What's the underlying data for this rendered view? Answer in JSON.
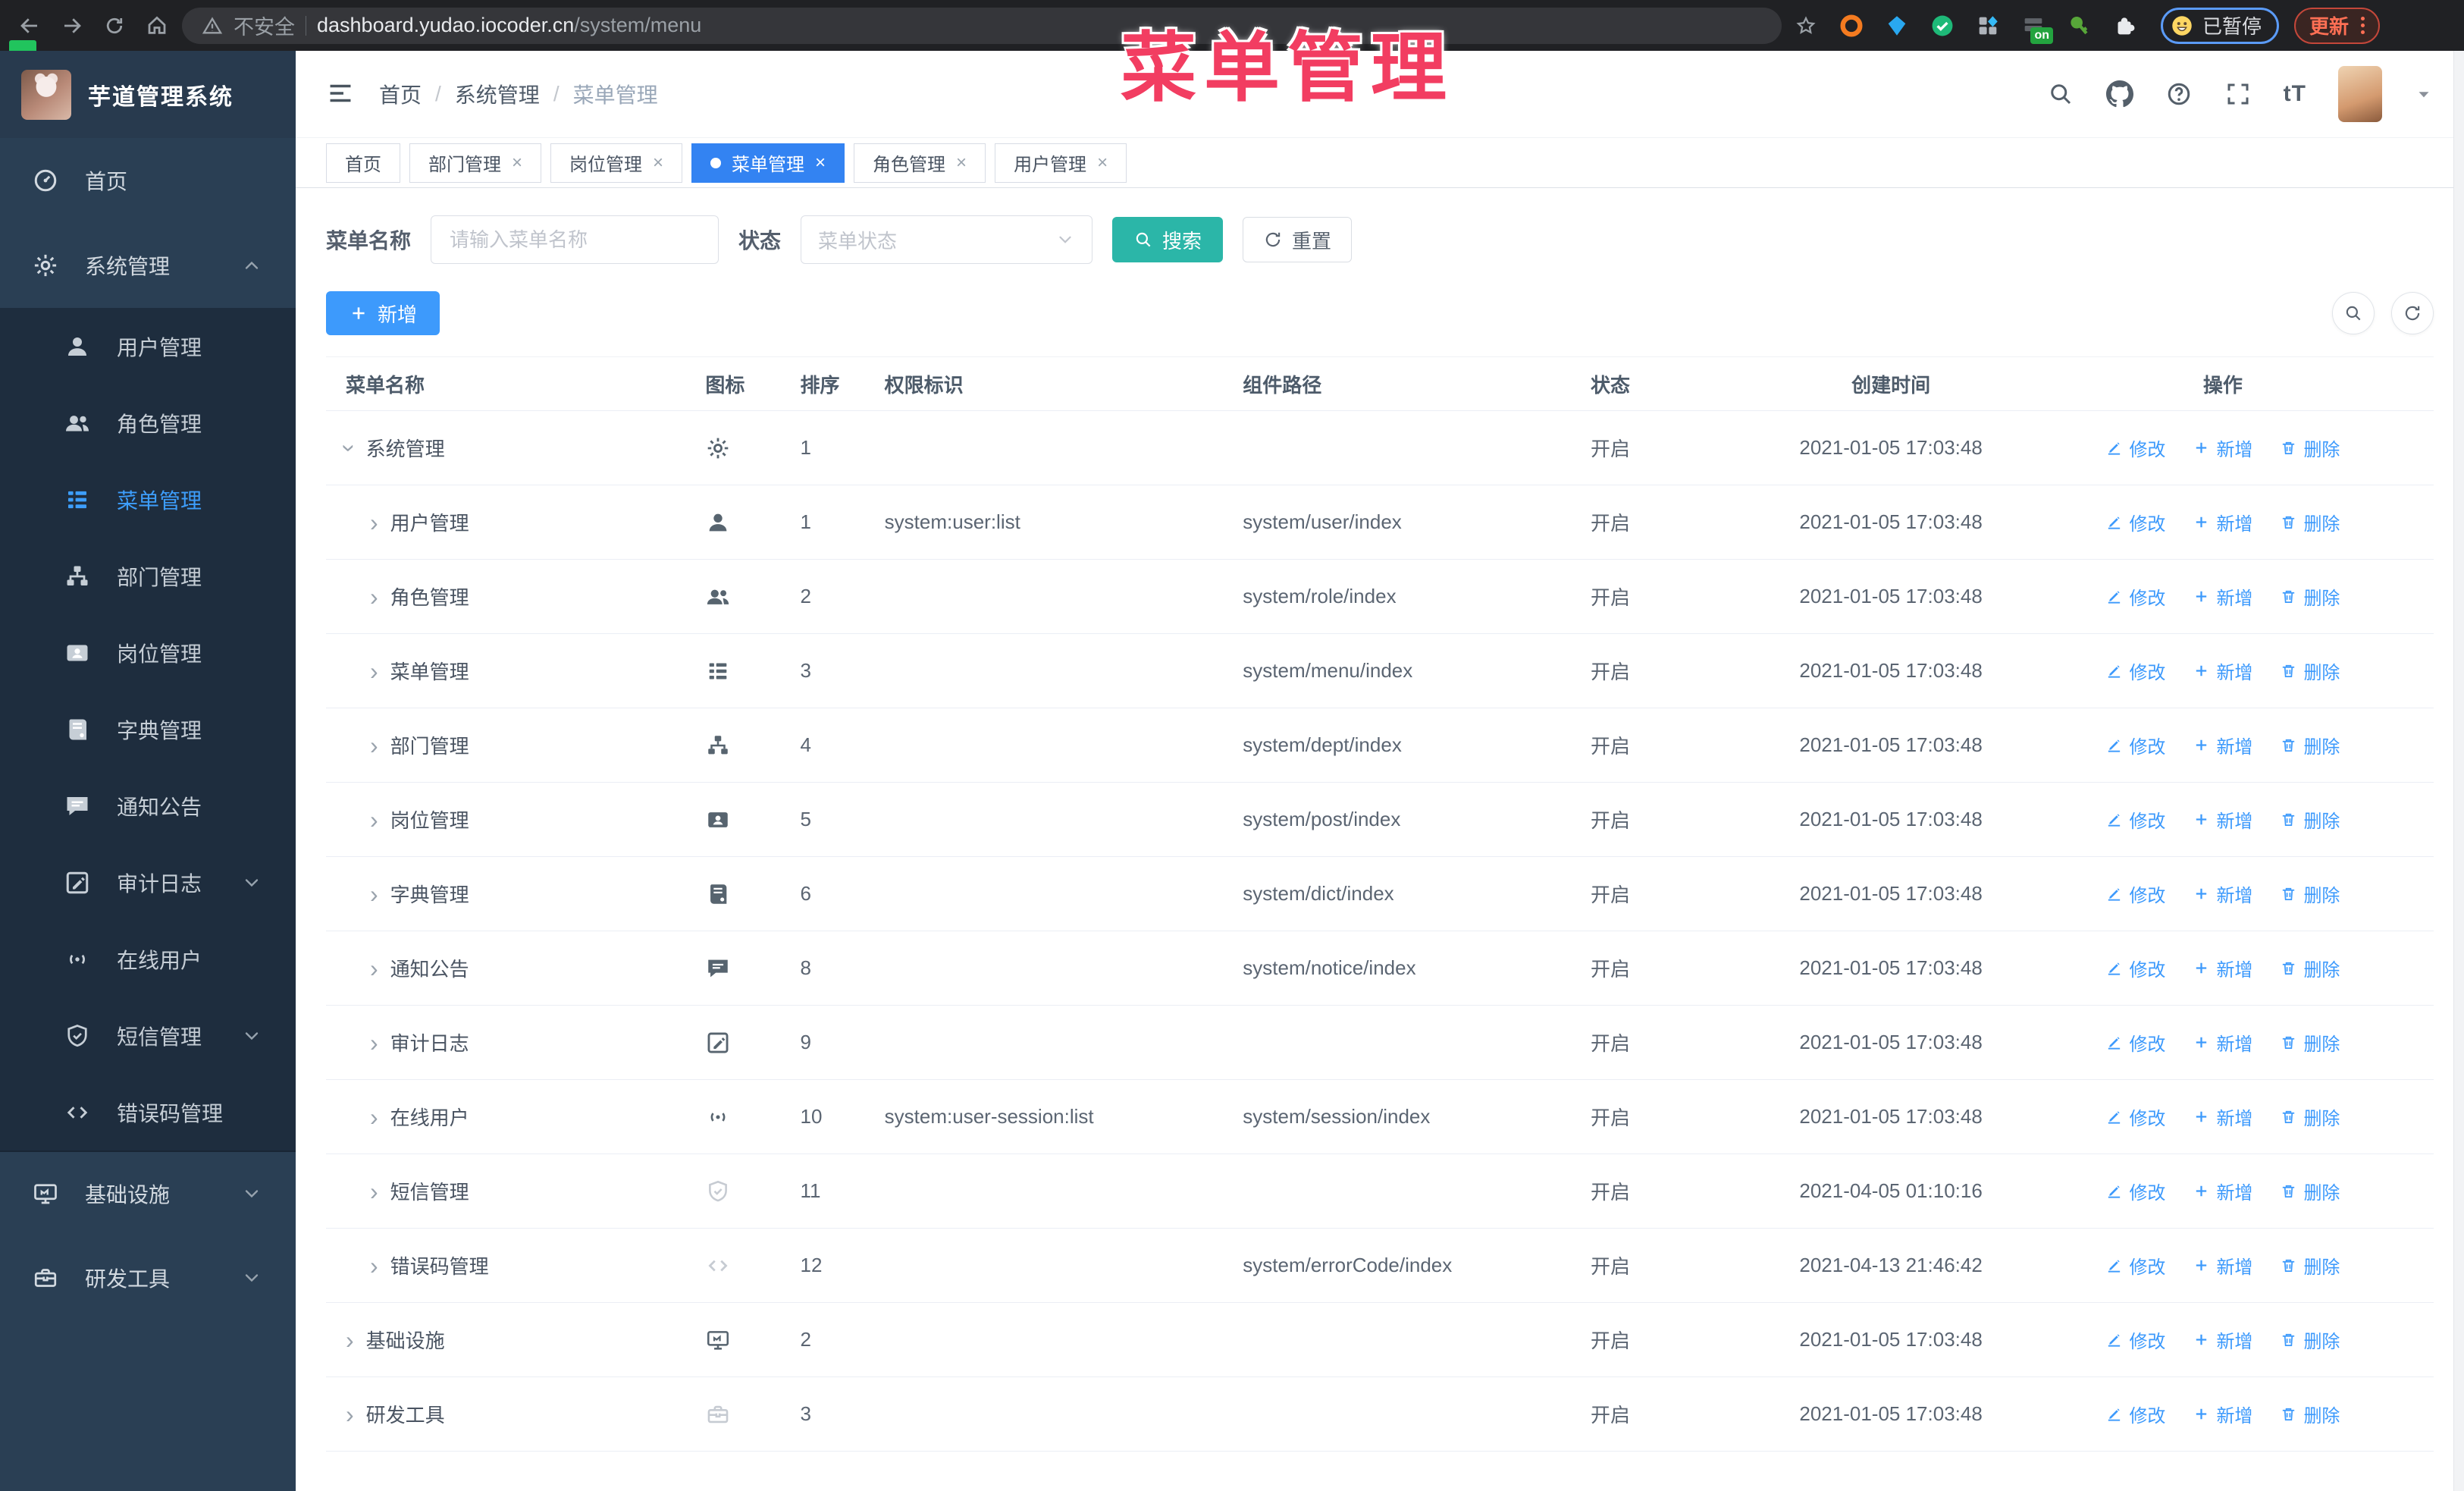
{
  "overlay_title": "菜单管理",
  "browser": {
    "security_label": "不安全",
    "url_host": "dashboard.yudao.iocoder.cn",
    "url_path": "/system/menu",
    "paused_label": "已暂停",
    "update_label": "更新"
  },
  "sidebar": {
    "app_title": "芋道管理系统",
    "items": [
      {
        "key": "home",
        "label": "首页",
        "icon": "dashboard-icon",
        "level": "root"
      },
      {
        "key": "system",
        "label": "系统管理",
        "icon": "gear-icon",
        "level": "root",
        "chevron": "up"
      },
      {
        "key": "user",
        "label": "用户管理",
        "icon": "user-icon",
        "level": "sub"
      },
      {
        "key": "role",
        "label": "角色管理",
        "icon": "users-icon",
        "level": "sub"
      },
      {
        "key": "menu",
        "label": "菜单管理",
        "icon": "menu-icon",
        "level": "sub",
        "active": true
      },
      {
        "key": "dept",
        "label": "部门管理",
        "icon": "tree-icon",
        "level": "sub"
      },
      {
        "key": "post",
        "label": "岗位管理",
        "icon": "idcard-icon",
        "level": "sub"
      },
      {
        "key": "dict",
        "label": "字典管理",
        "icon": "book-icon",
        "level": "sub"
      },
      {
        "key": "notice",
        "label": "通知公告",
        "icon": "message-icon",
        "level": "sub"
      },
      {
        "key": "audit",
        "label": "审计日志",
        "icon": "log-icon",
        "level": "sub",
        "chevron": "down"
      },
      {
        "key": "online",
        "label": "在线用户",
        "icon": "online-icon",
        "level": "sub"
      },
      {
        "key": "sms",
        "label": "短信管理",
        "icon": "shield-icon",
        "level": "sub",
        "chevron": "down"
      },
      {
        "key": "errcode",
        "label": "错误码管理",
        "icon": "code-icon",
        "level": "sub"
      },
      {
        "key": "infra",
        "label": "基础设施",
        "icon": "monitor-icon",
        "level": "root",
        "chevron": "down"
      },
      {
        "key": "devtools",
        "label": "研发工具",
        "icon": "toolbox-icon",
        "level": "root",
        "chevron": "down"
      }
    ]
  },
  "header": {
    "breadcrumb": [
      "首页",
      "系统管理",
      "菜单管理"
    ]
  },
  "tabs": [
    {
      "key": "home",
      "label": "首页",
      "closable": false,
      "active": false
    },
    {
      "key": "dept",
      "label": "部门管理",
      "closable": true,
      "active": false
    },
    {
      "key": "post",
      "label": "岗位管理",
      "closable": true,
      "active": false
    },
    {
      "key": "menu",
      "label": "菜单管理",
      "closable": true,
      "active": true
    },
    {
      "key": "role",
      "label": "角色管理",
      "closable": true,
      "active": false
    },
    {
      "key": "user",
      "label": "用户管理",
      "closable": true,
      "active": false
    }
  ],
  "filter": {
    "name_label": "菜单名称",
    "name_placeholder": "请输入菜单名称",
    "status_label": "状态",
    "status_placeholder": "菜单状态",
    "search_label": "搜索",
    "reset_label": "重置"
  },
  "toolbar": {
    "add_label": "新增"
  },
  "table": {
    "columns": [
      "菜单名称",
      "图标",
      "排序",
      "权限标识",
      "组件路径",
      "状态",
      "创建时间",
      "操作"
    ],
    "op_edit": "修改",
    "op_add": "新增",
    "op_delete": "删除",
    "rows": [
      {
        "name": "系统管理",
        "icon": "gear-icon",
        "muted": false,
        "level": 0,
        "expanded": true,
        "sort": "1",
        "perm": "",
        "path": "",
        "status": "开启",
        "time": "2021-01-05 17:03:48"
      },
      {
        "name": "用户管理",
        "icon": "user-icon",
        "muted": false,
        "level": 1,
        "expanded": false,
        "sort": "1",
        "perm": "system:user:list",
        "path": "system/user/index",
        "status": "开启",
        "time": "2021-01-05 17:03:48"
      },
      {
        "name": "角色管理",
        "icon": "users-icon",
        "muted": false,
        "level": 1,
        "expanded": false,
        "sort": "2",
        "perm": "",
        "path": "system/role/index",
        "status": "开启",
        "time": "2021-01-05 17:03:48"
      },
      {
        "name": "菜单管理",
        "icon": "menu-icon",
        "muted": false,
        "level": 1,
        "expanded": false,
        "sort": "3",
        "perm": "",
        "path": "system/menu/index",
        "status": "开启",
        "time": "2021-01-05 17:03:48"
      },
      {
        "name": "部门管理",
        "icon": "tree-icon",
        "muted": false,
        "level": 1,
        "expanded": false,
        "sort": "4",
        "perm": "",
        "path": "system/dept/index",
        "status": "开启",
        "time": "2021-01-05 17:03:48"
      },
      {
        "name": "岗位管理",
        "icon": "idcard-icon",
        "muted": false,
        "level": 1,
        "expanded": false,
        "sort": "5",
        "perm": "",
        "path": "system/post/index",
        "status": "开启",
        "time": "2021-01-05 17:03:48"
      },
      {
        "name": "字典管理",
        "icon": "book-icon",
        "muted": false,
        "level": 1,
        "expanded": false,
        "sort": "6",
        "perm": "",
        "path": "system/dict/index",
        "status": "开启",
        "time": "2021-01-05 17:03:48"
      },
      {
        "name": "通知公告",
        "icon": "message-icon",
        "muted": false,
        "level": 1,
        "expanded": false,
        "sort": "8",
        "perm": "",
        "path": "system/notice/index",
        "status": "开启",
        "time": "2021-01-05 17:03:48"
      },
      {
        "name": "审计日志",
        "icon": "log-icon",
        "muted": false,
        "level": 1,
        "expanded": false,
        "sort": "9",
        "perm": "",
        "path": "",
        "status": "开启",
        "time": "2021-01-05 17:03:48"
      },
      {
        "name": "在线用户",
        "icon": "online-icon",
        "muted": false,
        "level": 1,
        "expanded": false,
        "sort": "10",
        "perm": "system:user-session:list",
        "path": "system/session/index",
        "status": "开启",
        "time": "2021-01-05 17:03:48"
      },
      {
        "name": "短信管理",
        "icon": "shield-icon",
        "muted": true,
        "level": 1,
        "expanded": false,
        "sort": "11",
        "perm": "",
        "path": "",
        "status": "开启",
        "time": "2021-04-05 01:10:16"
      },
      {
        "name": "错误码管理",
        "icon": "code-icon",
        "muted": true,
        "level": 1,
        "expanded": false,
        "sort": "12",
        "perm": "",
        "path": "system/errorCode/index",
        "status": "开启",
        "time": "2021-04-13 21:46:42"
      },
      {
        "name": "基础设施",
        "icon": "monitor-icon",
        "muted": false,
        "level": 0,
        "expanded": false,
        "sort": "2",
        "perm": "",
        "path": "",
        "status": "开启",
        "time": "2021-01-05 17:03:48"
      },
      {
        "name": "研发工具",
        "icon": "toolbox-icon",
        "muted": true,
        "level": 0,
        "expanded": false,
        "sort": "3",
        "perm": "",
        "path": "",
        "status": "开启",
        "time": "2021-01-05 17:03:48"
      }
    ]
  }
}
